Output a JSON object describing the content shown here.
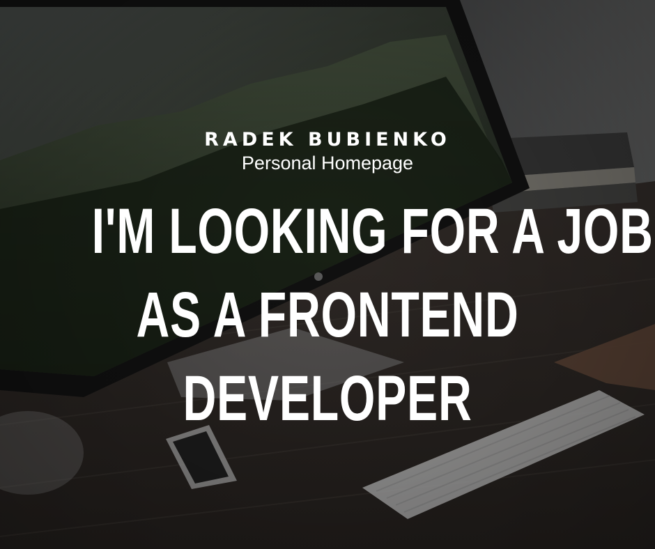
{
  "hero": {
    "name": "RADEK BUBIENKO",
    "subtitle": "Personal Homepage",
    "headline_lines": [
      "I'M LOOKING FOR A JOB",
      "AS A FRONTEND",
      "DEVELOPER"
    ]
  },
  "colors": {
    "text": "#ffffff",
    "background": "#1d1e1f"
  },
  "background_image": {
    "icon": "desk-with-computer-photo"
  }
}
